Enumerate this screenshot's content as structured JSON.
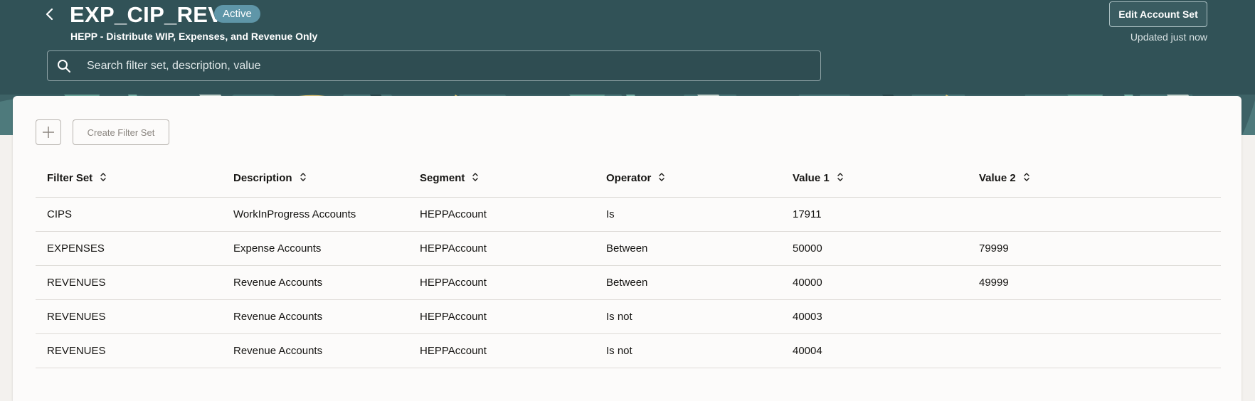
{
  "header": {
    "title": "EXP_CIP_REVS",
    "status_badge": "Active",
    "subtitle": "HEPP - Distribute WIP, Expenses, and Revenue Only",
    "edit_button_label": "Edit Account Set",
    "updated_text": "Updated just now",
    "colors": {
      "background": "#315257",
      "badge": "#5f96a8"
    }
  },
  "search": {
    "placeholder": "Search filter set, description, value",
    "value": ""
  },
  "toolbar": {
    "create_button_label": "Create Filter Set"
  },
  "table": {
    "columns": [
      "Filter Set",
      "Description",
      "Segment",
      "Operator",
      "Value 1",
      "Value 2"
    ],
    "rows": [
      [
        "CIPS",
        "WorkInProgress Accounts",
        "HEPPAccount",
        "Is",
        "17911",
        ""
      ],
      [
        "EXPENSES",
        "Expense Accounts",
        "HEPPAccount",
        "Between",
        "50000",
        "79999"
      ],
      [
        "REVENUES",
        "Revenue Accounts",
        "HEPPAccount",
        "Between",
        "40000",
        "49999"
      ],
      [
        "REVENUES",
        "Revenue Accounts",
        "HEPPAccount",
        "Is not",
        "40003",
        ""
      ],
      [
        "REVENUES",
        "Revenue Accounts",
        "HEPPAccount",
        "Is not",
        "40004",
        ""
      ]
    ]
  },
  "icons": {
    "back": "chevron-left-icon",
    "search": "search-icon",
    "add": "plus-icon",
    "sort": "sort-icon"
  }
}
